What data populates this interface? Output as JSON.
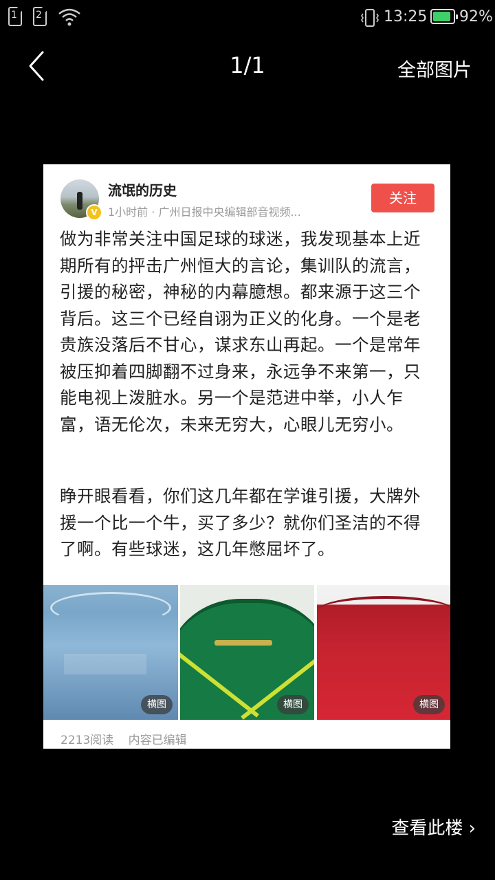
{
  "status_bar": {
    "sim1": "1",
    "sim2": "2",
    "time": "13:25",
    "battery_pct": "92%",
    "battery_level": 0.92,
    "icons": [
      "sim-card-icon",
      "sim-card-icon",
      "wifi-icon",
      "vibrate-icon",
      "battery-icon"
    ]
  },
  "nav": {
    "counter": "1/1",
    "all_images": "全部图片"
  },
  "post": {
    "username": "流氓的历史",
    "meta": "1小时前 · 广州日报中央编辑部音视频...",
    "follow_label": "关注",
    "verified_mark": "V",
    "paragraph1": "做为非常关注中国足球的球迷，我发现基本上近期所有的抨击广州恒大的言论，集训队的流言，引援的秘密，神秘的内幕臆想。都来源于这三个背后。这三个已经自诩为正义的化身。一个是老贵族没落后不甘心，谋求东山再起。一个是常年被压抑着四脚翻不过身来，永远争不来第一，只能电视上泼脏水。另一个是范进中举，小人乍富，语无伦次，未来无穷大，心眼儿无穷小。",
    "paragraph2": "睁开眼看看，你们这几年都在学谁引援，大牌外援一个比一个牛，买了多少？就你们圣洁的不得了啊。有些球迷，这几年憋屈坏了。",
    "thumb_tag": "横图",
    "reads": "2213阅读",
    "edited": "内容已编辑"
  },
  "bottom": {
    "view_floor": "查看此楼"
  },
  "colors": {
    "background": "#000000",
    "follow_button": "#f0504a",
    "battery_fill": "#3fcf6a",
    "verified_badge": "#f4c21b"
  }
}
